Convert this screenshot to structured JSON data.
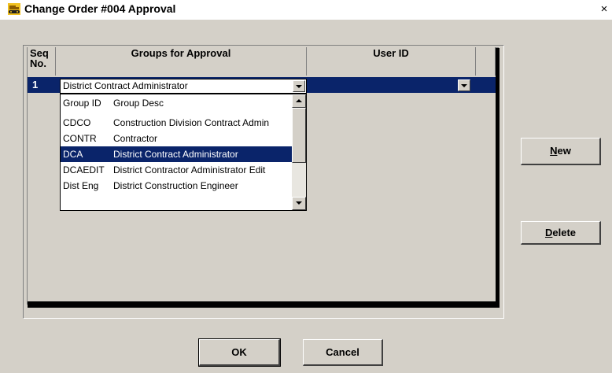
{
  "window": {
    "title": "Change Order #004 Approval",
    "close_glyph": "×",
    "app_icon": "bulldozer-icon"
  },
  "grid": {
    "columns": [
      "Seq\nNo.",
      "Groups for Approval",
      "User ID"
    ],
    "rows": [
      {
        "seq": "1",
        "group": "District Contract Administrator",
        "user_id": ""
      }
    ]
  },
  "dropdown": {
    "header": {
      "group_id": "Group ID",
      "group_desc": "Group Desc"
    },
    "items": [
      {
        "group_id": "CDCO",
        "group_desc": "Construction Division Contract Admin"
      },
      {
        "group_id": "CONTR",
        "group_desc": "Contractor"
      },
      {
        "group_id": "DCA",
        "group_desc": "District Contract Administrator",
        "selected": true
      },
      {
        "group_id": "DCAEDIT",
        "group_desc": "District Contractor Administrator Edit"
      },
      {
        "group_id": "Dist Eng",
        "group_desc": "District Construction Engineer"
      }
    ]
  },
  "buttons": {
    "new_mnemonic": "N",
    "new_rest": "ew",
    "delete_mnemonic": "D",
    "delete_rest": "elete",
    "ok": "OK",
    "cancel": "Cancel"
  },
  "colors": {
    "selection": "#0a246a",
    "face": "#d4d0c8"
  }
}
